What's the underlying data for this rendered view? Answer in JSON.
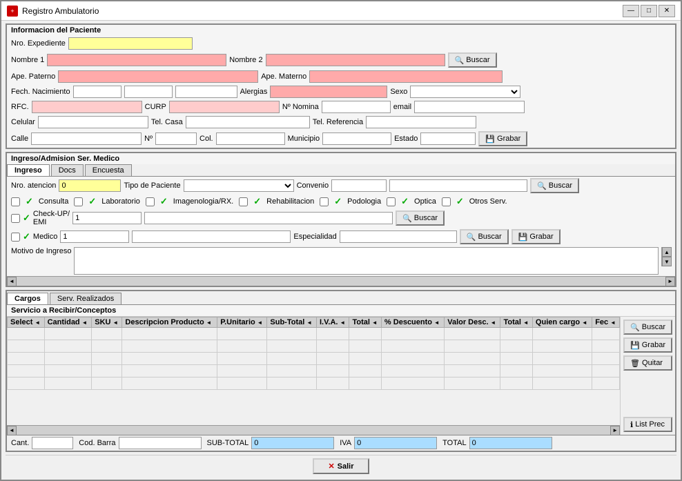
{
  "window": {
    "title": "Registro Ambulatorio",
    "icon": "R",
    "minimize": "—",
    "maximize": "□",
    "close": "✕"
  },
  "patient_section": {
    "title": "Informacion del Paciente",
    "nro_expediente_label": "Nro. Expediente",
    "nombre1_label": "Nombre 1",
    "nombre2_label": "Nombre 2",
    "ape_paterno_label": "Ape. Paterno",
    "ape_materno_label": "Ape. Materno",
    "fech_nacimiento_label": "Fech. Nacimiento",
    "alergias_label": "Alergias",
    "sexo_label": "Sexo",
    "rfc_label": "RFC.",
    "curp_label": "CURP",
    "nomina_label": "Nº Nomina",
    "email_label": "email",
    "celular_label": "Celular",
    "tel_casa_label": "Tel. Casa",
    "tel_referencia_label": "Tel. Referencia",
    "calle_label": "Calle",
    "no_label": "Nº",
    "col_label": "Col.",
    "municipio_label": "Municipio",
    "estado_label": "Estado",
    "buscar_label": "Buscar",
    "grabar_label": "Grabar"
  },
  "ingreso_section": {
    "title": "Ingreso/Admision Ser. Medico",
    "tabs": [
      "Ingreso",
      "Docs",
      "Encuesta"
    ],
    "active_tab": 0,
    "nro_atencion_label": "Nro. atencion",
    "nro_atencion_value": "0",
    "tipo_paciente_label": "Tipo de Paciente",
    "convenio_label": "Convenio",
    "buscar_label": "Buscar",
    "checkboxes": [
      {
        "label": "Consulta"
      },
      {
        "label": "Laboratorio"
      },
      {
        "label": "Imagenologia/RX."
      },
      {
        "label": "Rehabilitacion"
      },
      {
        "label": "Podologia"
      },
      {
        "label": "Optica"
      },
      {
        "label": "Otros Serv."
      }
    ],
    "checkup_label": "Check-UP/\nEMI",
    "checkup_value": "1",
    "buscar2_label": "Buscar",
    "medico_label": "Medico",
    "medico_value": "1",
    "especialidad_label": "Especialidad",
    "buscar3_label": "Buscar",
    "grabar3_label": "Grabar",
    "motivo_label": "Motivo de Ingreso"
  },
  "bottom_section": {
    "tabs": [
      "Cargos",
      "Serv. Realizados"
    ],
    "active_tab": 0,
    "servicios_title": "Servicio a Recibir/Conceptos",
    "columns": [
      {
        "label": "Select"
      },
      {
        "label": "Cantidad"
      },
      {
        "label": "SKU"
      },
      {
        "label": "Descripcion Producto"
      },
      {
        "label": "P.Unitario"
      },
      {
        "label": "Sub-Total"
      },
      {
        "label": "I.V.A."
      },
      {
        "label": "Total"
      },
      {
        "label": "% Descuento"
      },
      {
        "label": "Valor Desc."
      },
      {
        "label": "Total"
      },
      {
        "label": "Quien cargo"
      },
      {
        "label": "Fec"
      }
    ],
    "buscar_label": "Buscar",
    "grabar_label": "Grabar",
    "quitar_label": "Quitar",
    "list_prec_label": "List Prec",
    "footer": {
      "cant_label": "Cant.",
      "cod_barra_label": "Cod. Barra",
      "sub_total_label": "SUB-TOTAL",
      "sub_total_value": "0",
      "iva_label": "IVA",
      "iva_value": "0",
      "total_label": "TOTAL",
      "total_value": "0"
    }
  },
  "salir": {
    "label": "Salir"
  }
}
